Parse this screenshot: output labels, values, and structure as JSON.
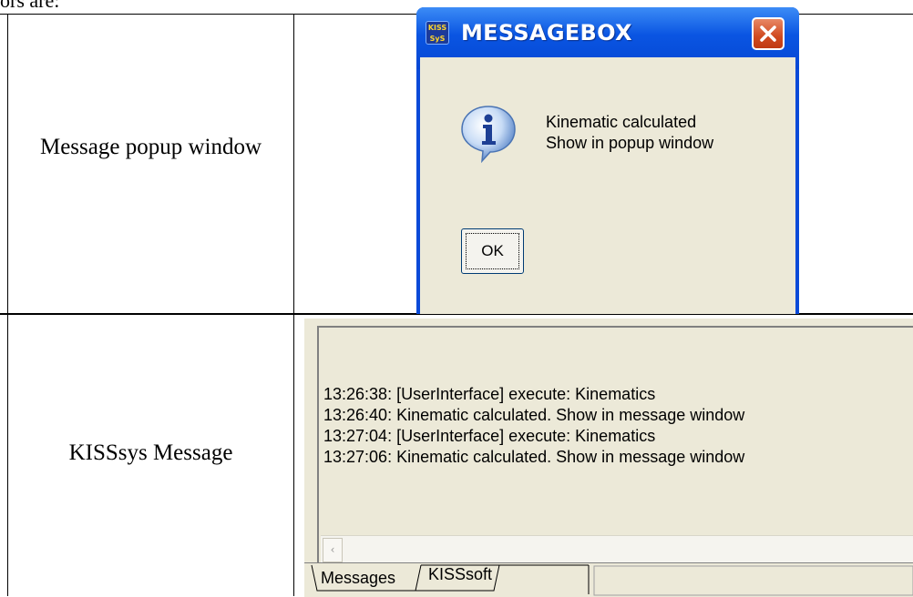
{
  "header_text": "ors are:",
  "rows": [
    {
      "label": "Message popup window"
    },
    {
      "label": "KISSsys Message"
    }
  ],
  "messagebox": {
    "logo_text": "KISS SyS",
    "title": "MESSAGEBOX",
    "icon": "info-icon",
    "message_lines": [
      "Kinematic calculated",
      "Show in popup window"
    ],
    "ok_label": "OK",
    "colors": {
      "title_bar": "#0a55e2",
      "client": "#ece9d8",
      "close_button": "#d04a20"
    }
  },
  "kisssys": {
    "log_lines": [
      "13:26:38: [UserInterface] execute: Kinematics",
      "13:26:40: Kinematic calculated. Show in message window",
      "13:27:04: [UserInterface] execute: Kinematics",
      "13:27:06: Kinematic calculated. Show in message window"
    ],
    "scroll_left_icon": "chevron-left-icon",
    "tabs": [
      "Messages",
      "KISSsoft"
    ]
  }
}
